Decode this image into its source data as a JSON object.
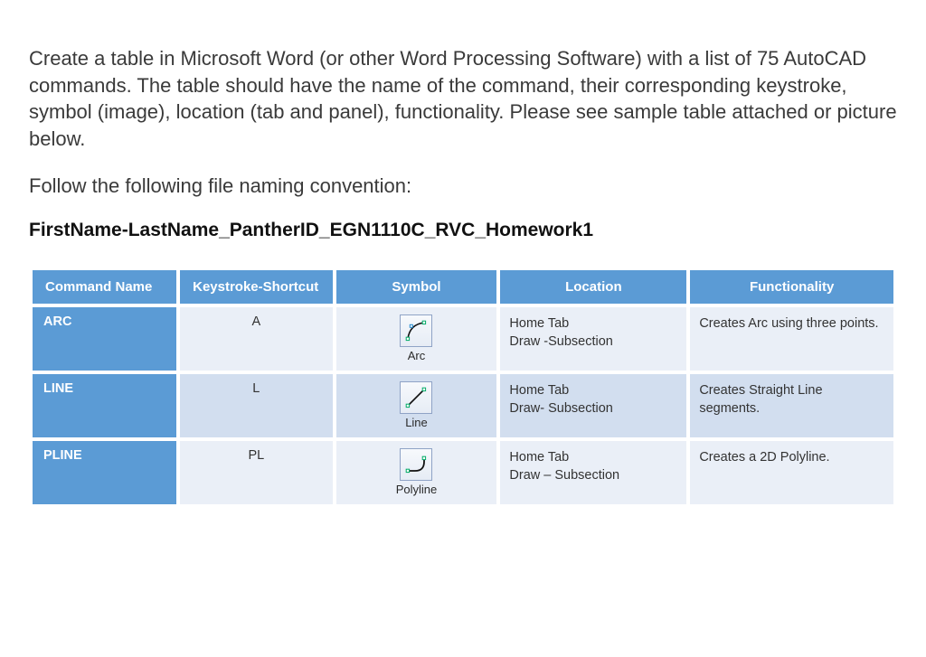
{
  "instructions": "Create a table in Microsoft Word (or other Word Processing Software) with a list of 75 AutoCAD commands.  The table should have the name of the command, their corresponding keystroke, symbol (image), location (tab and panel), functionality. Please see sample table attached or picture below.",
  "subhead": "Follow the following file naming convention:",
  "filename": "FirstName-LastName_PantherID_EGN1110C_RVC_Homework1",
  "table": {
    "headers": {
      "command": "Command Name",
      "keystroke": "Keystroke-Shortcut",
      "symbol": "Symbol",
      "location": "Location",
      "functionality": "Functionality"
    },
    "rows": [
      {
        "command": "ARC",
        "keystroke": "A",
        "symbol_label": "Arc",
        "symbol_icon": "arc-icon",
        "location_line1": "Home Tab",
        "location_line2": "Draw -Subsection",
        "functionality": "Creates Arc using three points."
      },
      {
        "command": "LINE",
        "keystroke": "L",
        "symbol_label": "Line",
        "symbol_icon": "line-icon",
        "location_line1": "Home Tab",
        "location_line2": "Draw- Subsection",
        "functionality": "Creates Straight Line segments."
      },
      {
        "command": "PLINE",
        "keystroke": "PL",
        "symbol_label": "Polyline",
        "symbol_icon": "polyline-icon",
        "location_line1": "Home Tab",
        "location_line2": "Draw – Subsection",
        "functionality": "Creates a 2D Polyline."
      }
    ]
  }
}
